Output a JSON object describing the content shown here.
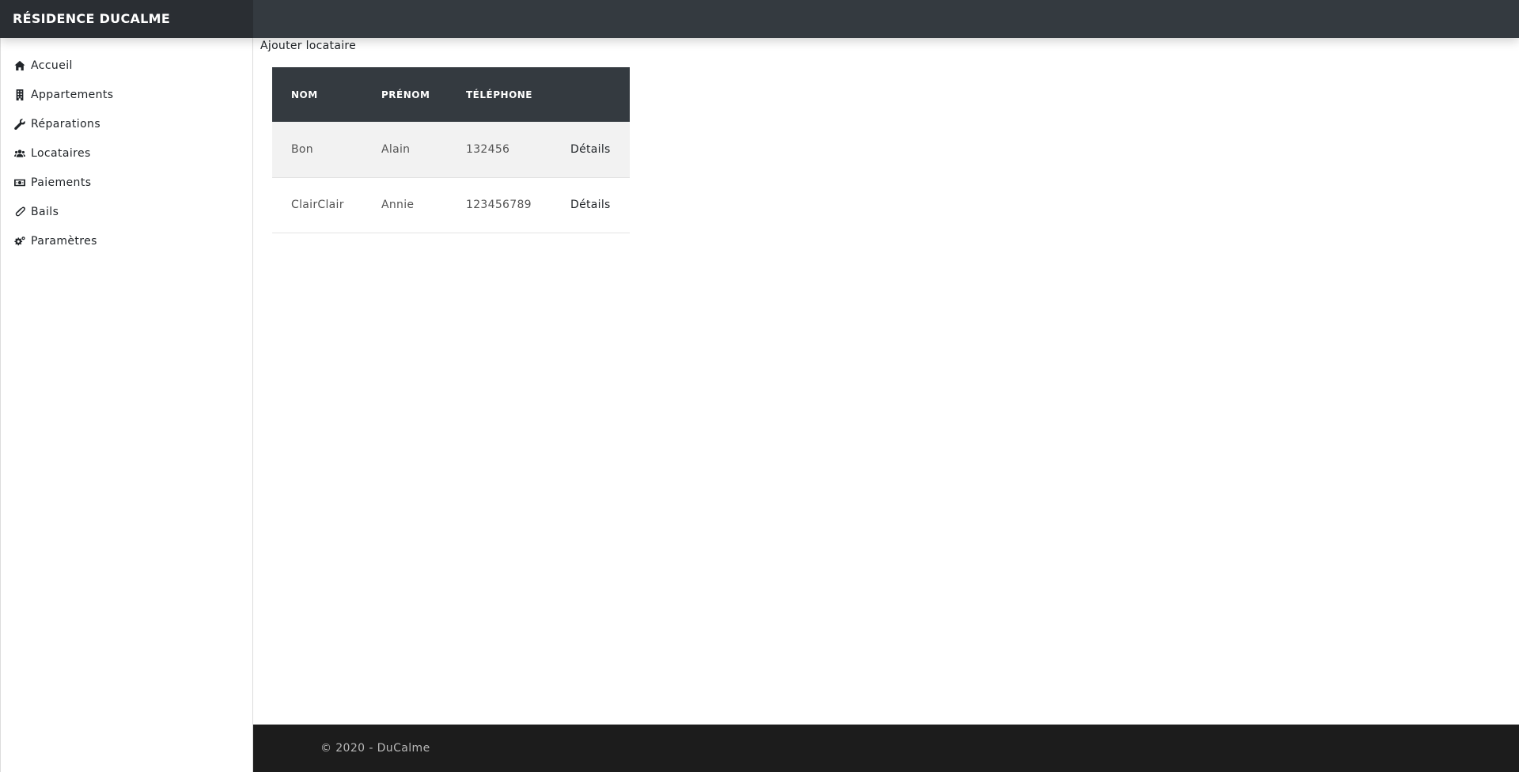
{
  "header": {
    "brand": "RÉSIDENCE DUCALME"
  },
  "sidebar": {
    "items": [
      {
        "label": "Accueil",
        "icon": "home-icon"
      },
      {
        "label": "Appartements",
        "icon": "building-icon"
      },
      {
        "label": "Réparations",
        "icon": "wrench-icon"
      },
      {
        "label": "Locataires",
        "icon": "users-icon"
      },
      {
        "label": "Paiements",
        "icon": "money-icon"
      },
      {
        "label": "Bails",
        "icon": "paperclip-icon"
      },
      {
        "label": "Paramètres",
        "icon": "gears-icon"
      }
    ]
  },
  "main": {
    "add_link": "Ajouter locataire",
    "table": {
      "headers": [
        "NOM",
        "PRÉNOM",
        "TÉLÉPHONE",
        ""
      ],
      "rows": [
        {
          "nom": "Bon",
          "prenom": "Alain",
          "telephone": "132456",
          "action": "Détails"
        },
        {
          "nom": "ClairClair",
          "prenom": "Annie",
          "telephone": "123456789",
          "action": "Détails"
        }
      ]
    }
  },
  "footer": {
    "text": "© 2020 - DuCalme"
  },
  "colors": {
    "topbar": "#343a40",
    "brand_bg": "#2a2e33",
    "table_header": "#343a40",
    "row_striped": "#f2f2f2",
    "footer": "#1c1c1c"
  }
}
